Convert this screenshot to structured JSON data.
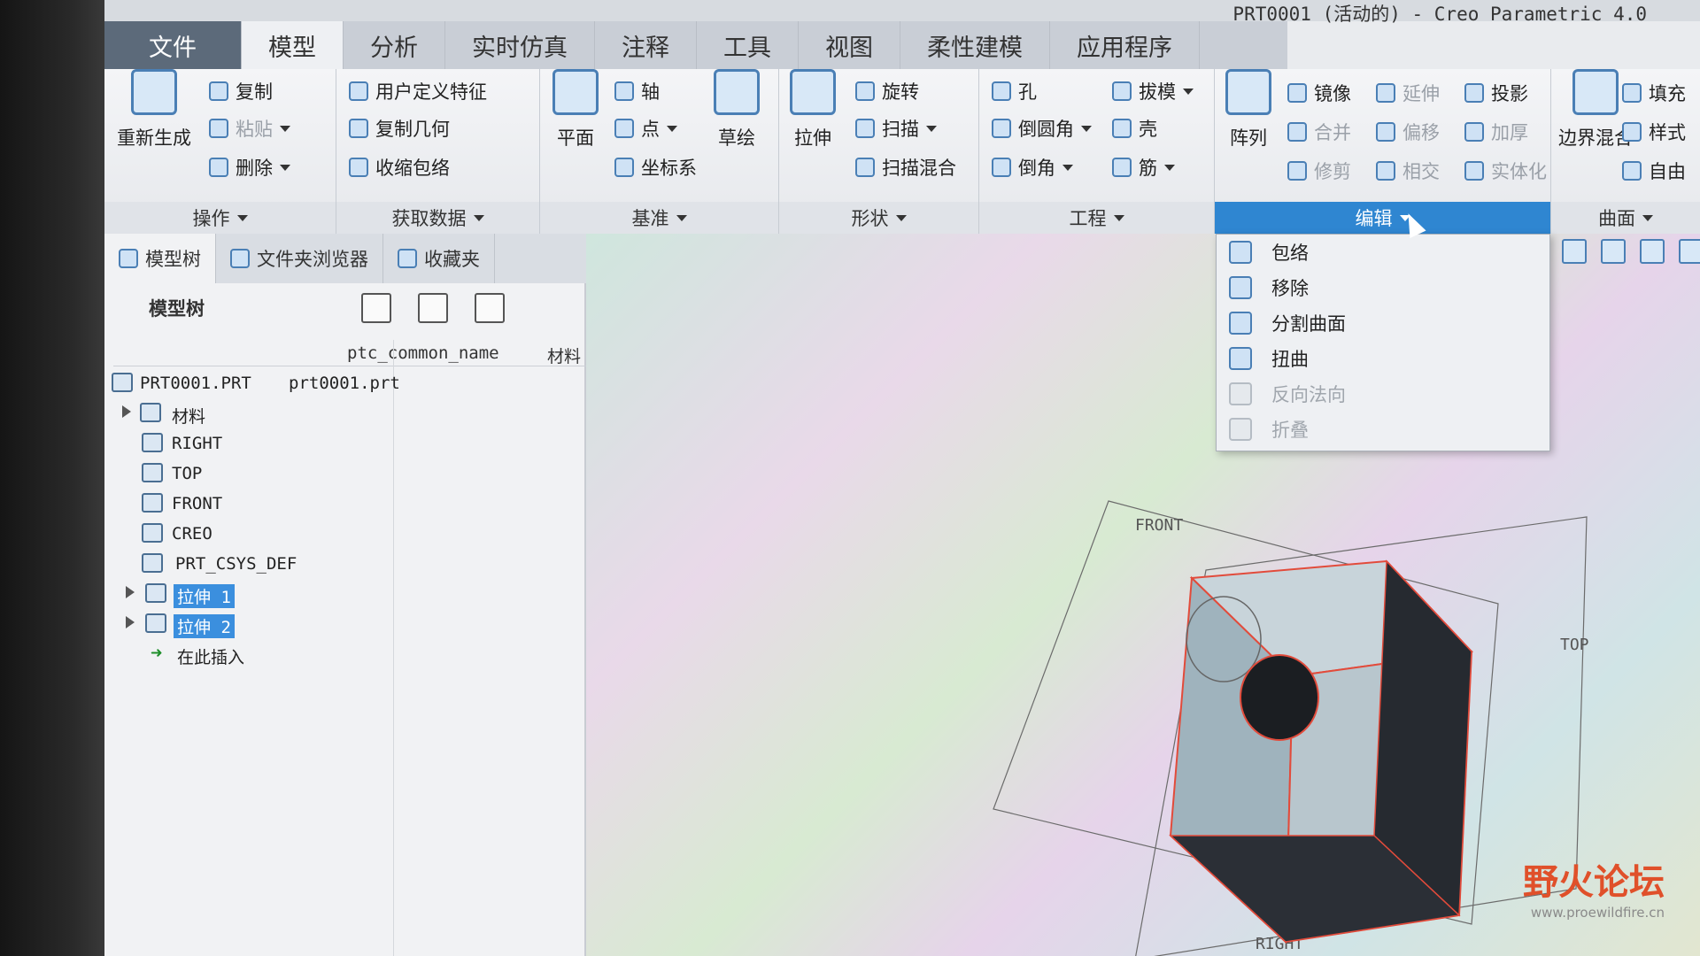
{
  "window": {
    "title": "PRT0001 (活动的) - Creo Parametric 4.0"
  },
  "tabs": [
    {
      "label": "文件"
    },
    {
      "label": "模型"
    },
    {
      "label": "分析"
    },
    {
      "label": "实时仿真"
    },
    {
      "label": "注释"
    },
    {
      "label": "工具"
    },
    {
      "label": "视图"
    },
    {
      "label": "柔性建模"
    },
    {
      "label": "应用程序"
    }
  ],
  "ribbon": {
    "operations": {
      "regenerate": "重新生成",
      "copy": "复制",
      "paste": "粘贴",
      "delete": "删除",
      "caption": "操作"
    },
    "get_data": {
      "udf": "用户定义特征",
      "copy_geom": "复制几何",
      "shrinkwrap": "收缩包络",
      "caption": "获取数据"
    },
    "datum": {
      "plane": "平面",
      "axis": "轴",
      "point": "点",
      "csys": "坐标系",
      "sketch": "草绘",
      "caption": "基准"
    },
    "shapes": {
      "extrude": "拉伸",
      "revolve": "旋转",
      "sweep": "扫描",
      "swept_blend": "扫描混合",
      "caption": "形状"
    },
    "engineering": {
      "hole": "孔",
      "draft": "拔模",
      "round": "倒圆角",
      "shell": "壳",
      "chamfer": "倒角",
      "rib": "筋",
      "caption": "工程"
    },
    "editing": {
      "pattern": "阵列",
      "mirror": "镜像",
      "extend": "延伸",
      "project": "投影",
      "merge": "合并",
      "offset": "偏移",
      "thicken": "加厚",
      "trim": "修剪",
      "intersect": "相交",
      "solidify": "实体化",
      "caption": "编辑"
    },
    "surfaces": {
      "boundary_blend": "边界混合",
      "fill": "填充",
      "style": "样式",
      "freestyle": "自由",
      "caption": "曲面"
    }
  },
  "panel": {
    "tabs": [
      {
        "label": "模型树"
      },
      {
        "label": "文件夹浏览器"
      },
      {
        "label": "收藏夹"
      }
    ],
    "toolbar_label": "模型树",
    "columns": {
      "name": "ptc_common_name",
      "material": "材料"
    },
    "tree": [
      {
        "label": "PRT0001.PRT",
        "value": "prt0001.prt"
      },
      {
        "label": "材料"
      },
      {
        "label": "RIGHT"
      },
      {
        "label": "TOP"
      },
      {
        "label": "FRONT"
      },
      {
        "label": "CREO"
      },
      {
        "label": "PRT_CSYS_DEF"
      },
      {
        "label": "拉伸 1"
      },
      {
        "label": "拉伸 2"
      },
      {
        "label": "在此插入"
      }
    ]
  },
  "edit_menu": {
    "items": [
      {
        "label": "包络",
        "enabled": true
      },
      {
        "label": "移除",
        "enabled": true
      },
      {
        "label": "分割曲面",
        "enabled": true
      },
      {
        "label": "扭曲",
        "enabled": true
      },
      {
        "label": "反向法向",
        "enabled": false
      },
      {
        "label": "折叠",
        "enabled": false
      }
    ]
  },
  "viewport": {
    "labels": {
      "front": "FRONT",
      "top": "TOP",
      "right": "RIGHT"
    }
  },
  "watermark": {
    "text": "野火论坛",
    "url": "www.proewildfire.cn"
  },
  "colors": {
    "accent": "#2f86d1",
    "selection": "#3b8fde",
    "datum_edge": "#e24b3b"
  }
}
